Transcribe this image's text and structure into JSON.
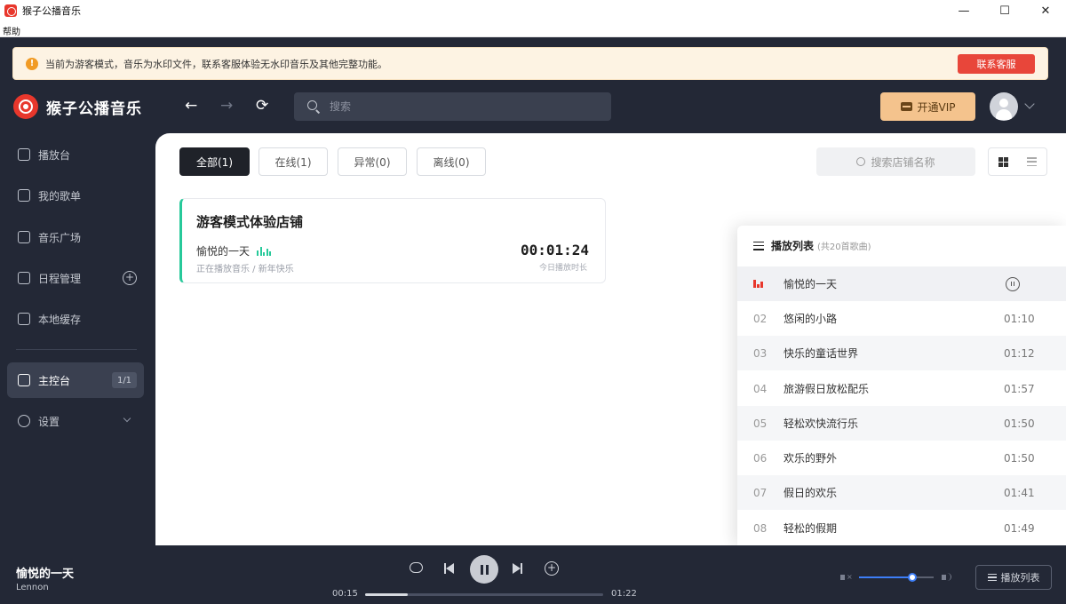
{
  "window": {
    "title": "猴子公播音乐",
    "controls": {
      "minimize": "—",
      "maximize": "☐",
      "close": "✕"
    }
  },
  "menubar": {
    "help": "帮助"
  },
  "notice": {
    "text": "当前为游客模式，音乐为水印文件，联系客服体验无水印音乐及其他完整功能。",
    "button": "联系客服",
    "icon": "warning-icon"
  },
  "header": {
    "brand": "猴子公播音乐",
    "search_placeholder": "搜索",
    "vip_button": "开通VIP"
  },
  "sidebar": {
    "items": [
      {
        "label": "播放台",
        "icon": "home-icon"
      },
      {
        "label": "我的歌单",
        "icon": "playlist-icon"
      },
      {
        "label": "音乐广场",
        "icon": "radio-icon"
      },
      {
        "label": "日程管理",
        "icon": "calendar-icon"
      },
      {
        "label": "本地缓存",
        "icon": "download-icon"
      },
      {
        "label": "主控台",
        "icon": "monitor-icon",
        "badge": "1/1"
      },
      {
        "label": "设置",
        "icon": "gear-icon"
      }
    ]
  },
  "filters": {
    "tabs": [
      "全部(1)",
      "在线(1)",
      "异常(0)",
      "离线(0)"
    ],
    "active": 0,
    "store_search_placeholder": "搜索店铺名称"
  },
  "store_card": {
    "name": "游客模式体验店铺",
    "song": "愉悦的一天",
    "status": "正在播放音乐 / 新年快乐",
    "time": "00:01:24",
    "time_label": "今日播放时长"
  },
  "playlist": {
    "title": "播放列表",
    "count": "(共20首歌曲)",
    "rows": [
      {
        "no": "",
        "name": "愉悦的一天",
        "duration": ""
      },
      {
        "no": "02",
        "name": "悠闲的小路",
        "duration": "01:10"
      },
      {
        "no": "03",
        "name": "快乐的童话世界",
        "duration": "01:12"
      },
      {
        "no": "04",
        "name": "旅游假日放松配乐",
        "duration": "01:57"
      },
      {
        "no": "05",
        "name": "轻松欢快流行乐",
        "duration": "01:50"
      },
      {
        "no": "06",
        "name": "欢乐的野外",
        "duration": "01:50"
      },
      {
        "no": "07",
        "name": "假日的欢乐",
        "duration": "01:41"
      },
      {
        "no": "08",
        "name": "轻松的假期",
        "duration": "01:49"
      }
    ]
  },
  "player": {
    "title": "愉悦的一天",
    "artist": "Lennon",
    "current_time": "00:15",
    "total_time": "01:22",
    "progress": 0.18,
    "volume": 0.71,
    "playlist_button": "播放列表"
  },
  "colors": {
    "accent": "#e8372c",
    "online": "#27c99a",
    "volume": "#3d7ef7",
    "dark": "#232836"
  }
}
